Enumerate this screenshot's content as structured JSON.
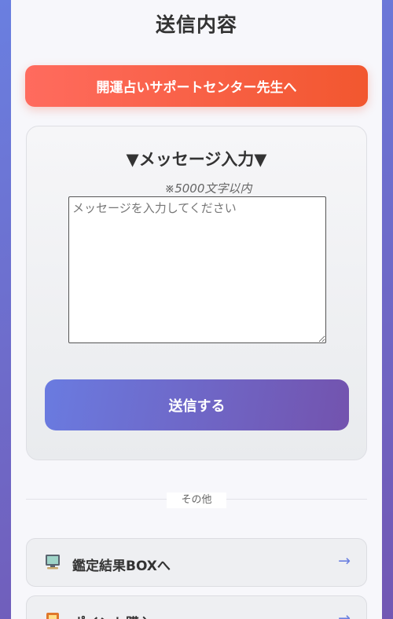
{
  "header": {
    "title": "送信内容"
  },
  "recipient": {
    "label": "開運占いサポートセンター先生へ"
  },
  "message_form": {
    "heading": "▼メッセージ入力▼",
    "limit_note": "※5000文字以内",
    "placeholder": "メッセージを入力してください",
    "value": "",
    "submit_label": "送信する"
  },
  "other_section": {
    "label": "その他",
    "items": [
      {
        "label": "鑑定結果BOXへ",
        "icon": "computer-icon",
        "arrow": "→"
      },
      {
        "label": "ポイント購入",
        "icon": "shop-icon",
        "arrow": "→"
      }
    ]
  },
  "colors": {
    "background_start": "#6a7fe0",
    "background_end": "#7257b3",
    "banner_start": "#ff6b5e",
    "banner_end": "#f2572f",
    "button_start": "#6a7be0",
    "button_end": "#7353ae",
    "arrow": "#6a7fe0"
  }
}
